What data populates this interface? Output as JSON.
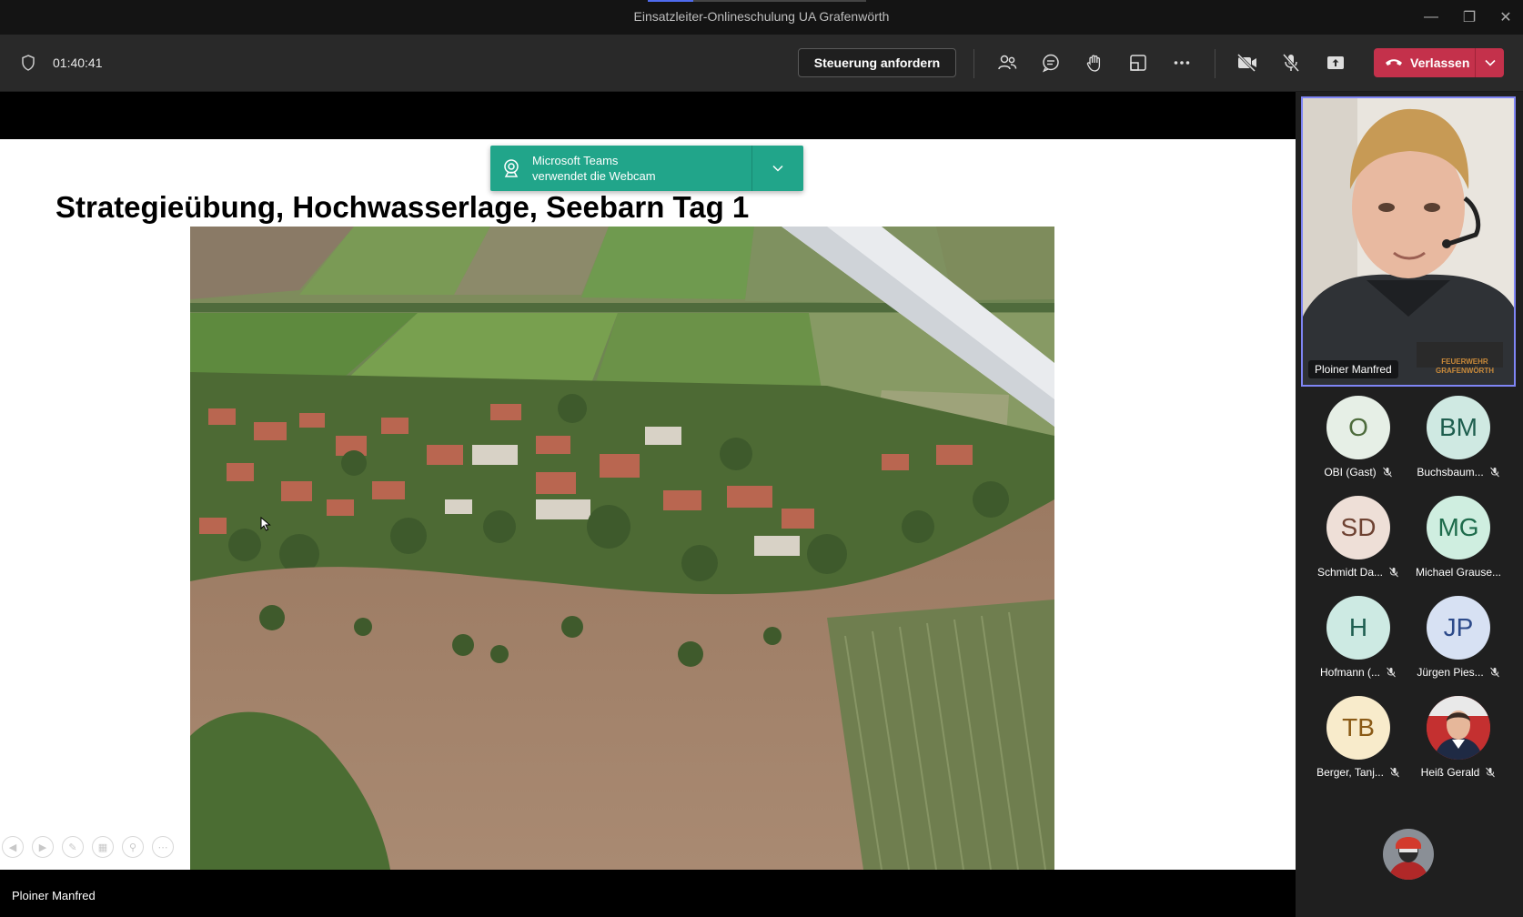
{
  "window": {
    "title": "Einsatzleiter-Onlineschulung UA Grafenwörth"
  },
  "toolbar": {
    "timer": "01:40:41",
    "request_control": "Steuerung anfordern",
    "leave_label": "Verlassen"
  },
  "notification": {
    "line1": "Microsoft Teams",
    "line2": "verwendet die Webcam"
  },
  "slide": {
    "title": "Strategieübung, Hochwasserlage, Seebarn Tag 1"
  },
  "stage": {
    "presenter_name": "Ploiner Manfred"
  },
  "video": {
    "name": "Ploiner Manfred",
    "badge_text": "FEUERWEHR GRAFENWÖRTH"
  },
  "participants": [
    {
      "initials": "O",
      "name": "OBI (Gast)",
      "bg": "#e6efe6",
      "fg": "#4d6b3c"
    },
    {
      "initials": "BM",
      "name": "Buchsbaum...",
      "bg": "#cfe9e2",
      "fg": "#1e5e4e"
    },
    {
      "initials": "SD",
      "name": "Schmidt Da...",
      "bg": "#eedfd7",
      "fg": "#6e4232"
    },
    {
      "initials": "MG",
      "name": "Michael Grause...",
      "bg": "#cfeee0",
      "fg": "#1d6b4b"
    },
    {
      "initials": "H",
      "name": "Hofmann (...",
      "bg": "#cdeae3",
      "fg": "#1e5e50"
    },
    {
      "initials": "JP",
      "name": "Jürgen Pies...",
      "bg": "#d7e1f3",
      "fg": "#2c4a8a"
    },
    {
      "initials": "TB",
      "name": "Berger, Tanj...",
      "bg": "#f8ebcb",
      "fg": "#8a5a16"
    },
    {
      "initials": "",
      "name": "Heiß Gerald",
      "bg": "#c43030",
      "fg": "#ffffff"
    }
  ],
  "colors": {
    "accent": "#7f85f5",
    "leave": "#c4314b",
    "notification": "#21a58a"
  }
}
